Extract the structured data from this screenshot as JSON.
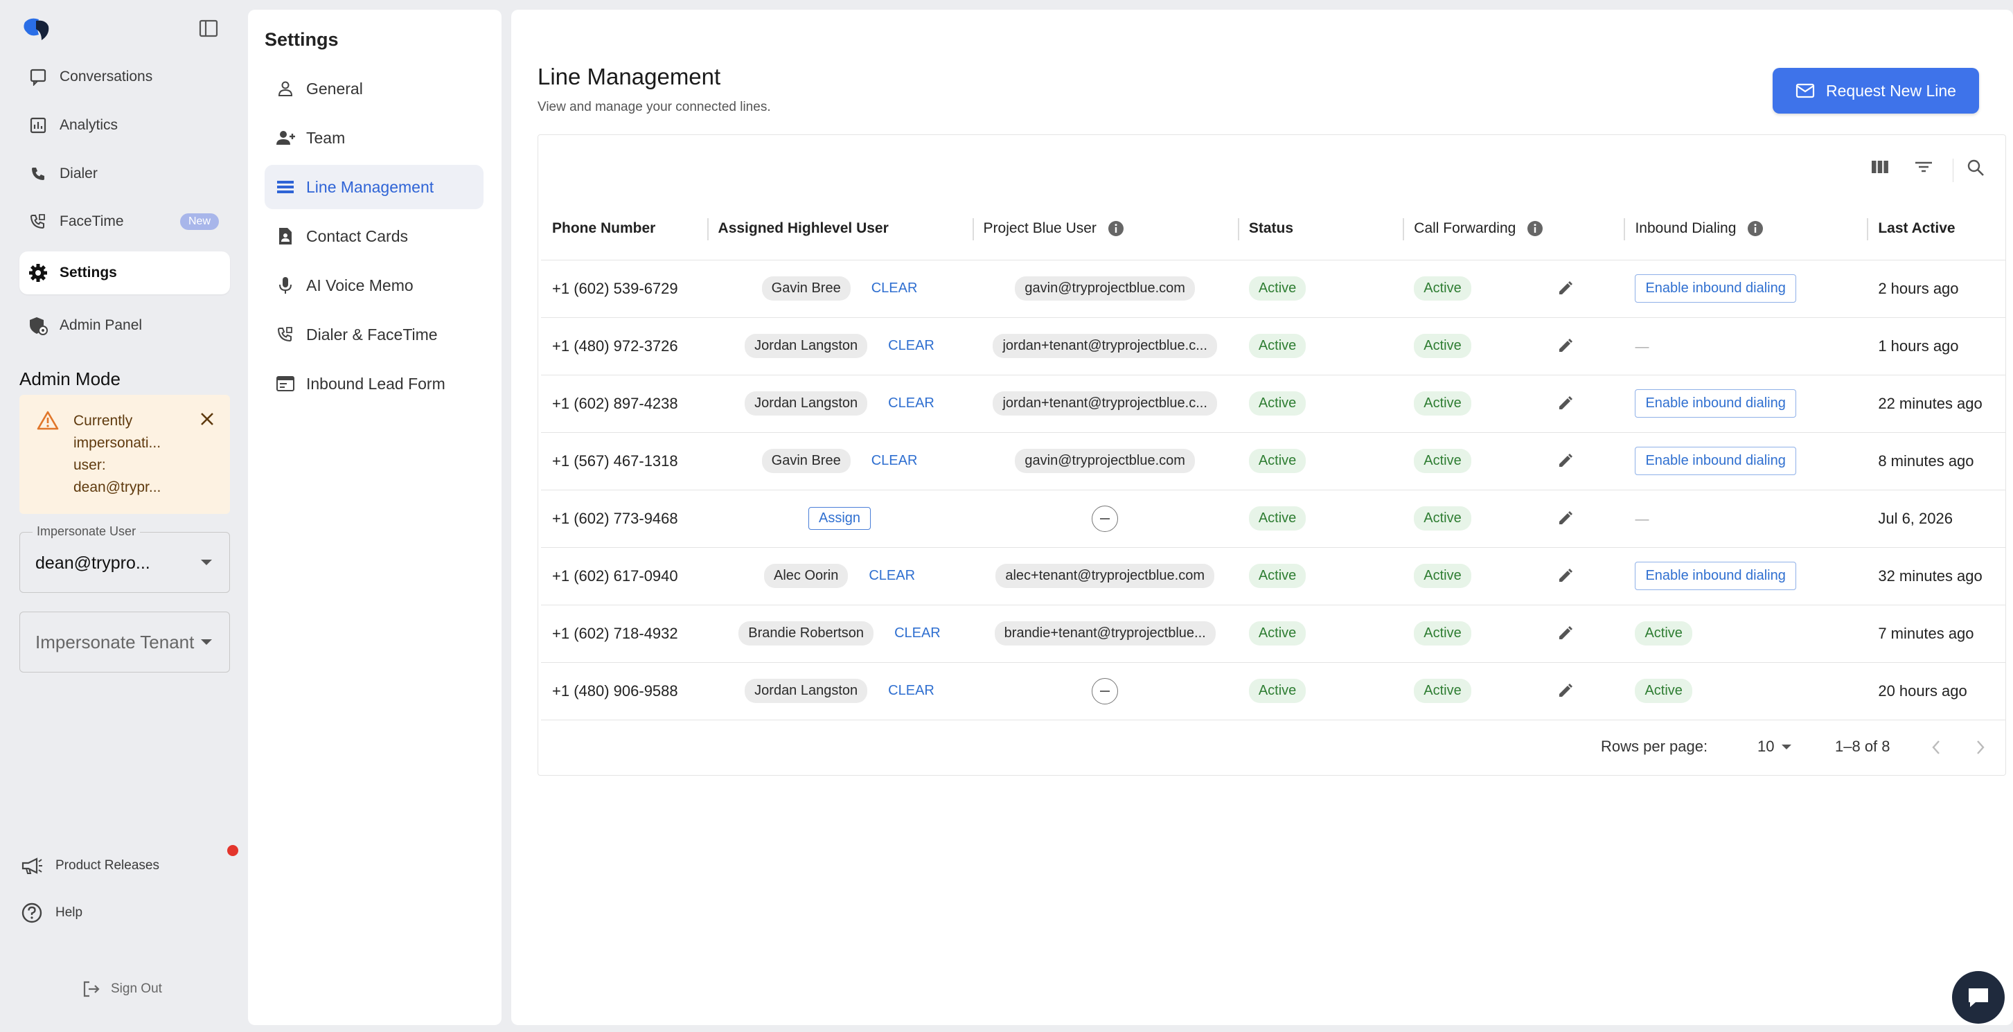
{
  "nav": {
    "items": [
      {
        "label": "Conversations",
        "icon": "chat-bubble-icon"
      },
      {
        "label": "Analytics",
        "icon": "analytics-icon"
      },
      {
        "label": "Dialer",
        "icon": "phone-icon"
      },
      {
        "label": "FaceTime",
        "icon": "phone-video-icon",
        "badge": "New"
      },
      {
        "label": "Settings",
        "icon": "gear-icon",
        "active": true
      },
      {
        "label": "Admin Panel",
        "icon": "admin-shield-icon"
      }
    ],
    "admin_mode": "Admin Mode",
    "impersonation_alert": "Currently impersonati... user: dean@trypr...",
    "impersonate_user_label": "Impersonate User",
    "impersonate_user_value": "dean@trypro...",
    "impersonate_tenant_placeholder": "Impersonate Tenant",
    "product_releases": "Product Releases",
    "help": "Help",
    "sign_out": "Sign Out"
  },
  "settings": {
    "title": "Settings",
    "items": [
      {
        "label": "General",
        "icon": "person-icon"
      },
      {
        "label": "Team",
        "icon": "team-add-icon"
      },
      {
        "label": "Line Management",
        "icon": "list-icon",
        "active": true
      },
      {
        "label": "Contact Cards",
        "icon": "contact-card-icon"
      },
      {
        "label": "AI Voice Memo",
        "icon": "microphone-icon"
      },
      {
        "label": "Dialer & FaceTime",
        "icon": "phone-video-icon"
      },
      {
        "label": "Inbound Lead Form",
        "icon": "form-icon"
      }
    ]
  },
  "main": {
    "title": "Line Management",
    "subtitle": "View and manage your connected lines.",
    "request_button": "Request New Line"
  },
  "table": {
    "columns": [
      "Phone Number",
      "Assigned Highlevel User",
      "Project Blue User",
      "Status",
      "Call Forwarding",
      "Inbound Dialing",
      "Last Active"
    ],
    "clear_label": "CLEAR",
    "assign_label": "Assign",
    "rows": [
      {
        "phone": "+1 (602) 539-6729",
        "user": "Gavin Bree",
        "pb_user": "gavin@tryprojectblue.com",
        "status": "Active",
        "forwarding": "Active",
        "inbound": "Enable inbound dialing",
        "inbound_type": "button",
        "last_active": "2 hours ago"
      },
      {
        "phone": "+1 (480) 972-3726",
        "user": "Jordan Langston",
        "pb_user": "jordan+tenant@tryprojectblue.c...",
        "status": "Active",
        "forwarding": "Active",
        "inbound": "—",
        "inbound_type": "dash",
        "last_active": "1 hours ago"
      },
      {
        "phone": "+1 (602) 897-4238",
        "user": "Jordan Langston",
        "pb_user": "jordan+tenant@tryprojectblue.c...",
        "status": "Active",
        "forwarding": "Active",
        "inbound": "Enable inbound dialing",
        "inbound_type": "button",
        "last_active": "22 minutes ago"
      },
      {
        "phone": "+1 (567) 467-1318",
        "user": "Gavin Bree",
        "pb_user": "gavin@tryprojectblue.com",
        "status": "Active",
        "forwarding": "Active",
        "inbound": "Enable inbound dialing",
        "inbound_type": "button",
        "last_active": "8 minutes ago"
      },
      {
        "phone": "+1 (602) 773-9468",
        "user": "",
        "pb_user": "",
        "status": "Active",
        "forwarding": "Active",
        "inbound": "—",
        "inbound_type": "dash",
        "last_active": "Jul 6, 2026"
      },
      {
        "phone": "+1 (602) 617-0940",
        "user": "Alec Oorin",
        "pb_user": "alec+tenant@tryprojectblue.com",
        "status": "Active",
        "forwarding": "Active",
        "inbound": "Enable inbound dialing",
        "inbound_type": "button",
        "last_active": "32 minutes ago"
      },
      {
        "phone": "+1 (602) 718-4932",
        "user": "Brandie Robertson",
        "pb_user": "brandie+tenant@tryprojectblue...",
        "status": "Active",
        "forwarding": "Active",
        "inbound": "Active",
        "inbound_type": "status",
        "last_active": "7 minutes ago"
      },
      {
        "phone": "+1 (480) 906-9588",
        "user": "Jordan Langston",
        "pb_user": "",
        "status": "Active",
        "forwarding": "Active",
        "inbound": "Active",
        "inbound_type": "status",
        "last_active": "20 hours ago"
      }
    ],
    "rows_per_page_label": "Rows per page:",
    "rows_per_page_value": "10",
    "range": "1–8 of 8"
  },
  "colors": {
    "accent": "#3e73ea",
    "link": "#2f6fd0",
    "status_green": "#2e7d32",
    "status_green_bg": "#e7f4e8",
    "alert_bg": "#fdf2e2",
    "alert_icon": "#e0762a",
    "notification_dot": "#e3352c"
  }
}
